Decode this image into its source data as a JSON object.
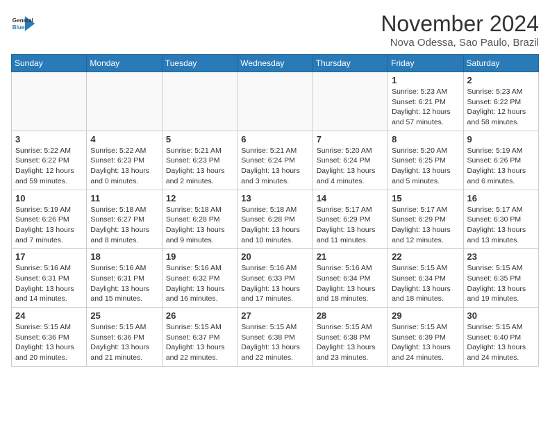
{
  "header": {
    "logo_line1": "General",
    "logo_line2": "Blue",
    "month": "November 2024",
    "location": "Nova Odessa, Sao Paulo, Brazil"
  },
  "weekdays": [
    "Sunday",
    "Monday",
    "Tuesday",
    "Wednesday",
    "Thursday",
    "Friday",
    "Saturday"
  ],
  "weeks": [
    [
      {
        "day": null
      },
      {
        "day": null
      },
      {
        "day": null
      },
      {
        "day": null
      },
      {
        "day": null
      },
      {
        "day": 1,
        "sunrise": "5:23 AM",
        "sunset": "6:21 PM",
        "daylight": "12 hours and 57 minutes"
      },
      {
        "day": 2,
        "sunrise": "5:23 AM",
        "sunset": "6:22 PM",
        "daylight": "12 hours and 58 minutes"
      }
    ],
    [
      {
        "day": 3,
        "sunrise": "5:22 AM",
        "sunset": "6:22 PM",
        "daylight": "12 hours and 59 minutes"
      },
      {
        "day": 4,
        "sunrise": "5:22 AM",
        "sunset": "6:23 PM",
        "daylight": "13 hours and 0 minutes"
      },
      {
        "day": 5,
        "sunrise": "5:21 AM",
        "sunset": "6:23 PM",
        "daylight": "13 hours and 2 minutes"
      },
      {
        "day": 6,
        "sunrise": "5:21 AM",
        "sunset": "6:24 PM",
        "daylight": "13 hours and 3 minutes"
      },
      {
        "day": 7,
        "sunrise": "5:20 AM",
        "sunset": "6:24 PM",
        "daylight": "13 hours and 4 minutes"
      },
      {
        "day": 8,
        "sunrise": "5:20 AM",
        "sunset": "6:25 PM",
        "daylight": "13 hours and 5 minutes"
      },
      {
        "day": 9,
        "sunrise": "5:19 AM",
        "sunset": "6:26 PM",
        "daylight": "13 hours and 6 minutes"
      }
    ],
    [
      {
        "day": 10,
        "sunrise": "5:19 AM",
        "sunset": "6:26 PM",
        "daylight": "13 hours and 7 minutes"
      },
      {
        "day": 11,
        "sunrise": "5:18 AM",
        "sunset": "6:27 PM",
        "daylight": "13 hours and 8 minutes"
      },
      {
        "day": 12,
        "sunrise": "5:18 AM",
        "sunset": "6:28 PM",
        "daylight": "13 hours and 9 minutes"
      },
      {
        "day": 13,
        "sunrise": "5:18 AM",
        "sunset": "6:28 PM",
        "daylight": "13 hours and 10 minutes"
      },
      {
        "day": 14,
        "sunrise": "5:17 AM",
        "sunset": "6:29 PM",
        "daylight": "13 hours and 11 minutes"
      },
      {
        "day": 15,
        "sunrise": "5:17 AM",
        "sunset": "6:29 PM",
        "daylight": "13 hours and 12 minutes"
      },
      {
        "day": 16,
        "sunrise": "5:17 AM",
        "sunset": "6:30 PM",
        "daylight": "13 hours and 13 minutes"
      }
    ],
    [
      {
        "day": 17,
        "sunrise": "5:16 AM",
        "sunset": "6:31 PM",
        "daylight": "13 hours and 14 minutes"
      },
      {
        "day": 18,
        "sunrise": "5:16 AM",
        "sunset": "6:31 PM",
        "daylight": "13 hours and 15 minutes"
      },
      {
        "day": 19,
        "sunrise": "5:16 AM",
        "sunset": "6:32 PM",
        "daylight": "13 hours and 16 minutes"
      },
      {
        "day": 20,
        "sunrise": "5:16 AM",
        "sunset": "6:33 PM",
        "daylight": "13 hours and 17 minutes"
      },
      {
        "day": 21,
        "sunrise": "5:16 AM",
        "sunset": "6:34 PM",
        "daylight": "13 hours and 18 minutes"
      },
      {
        "day": 22,
        "sunrise": "5:15 AM",
        "sunset": "6:34 PM",
        "daylight": "13 hours and 18 minutes"
      },
      {
        "day": 23,
        "sunrise": "5:15 AM",
        "sunset": "6:35 PM",
        "daylight": "13 hours and 19 minutes"
      }
    ],
    [
      {
        "day": 24,
        "sunrise": "5:15 AM",
        "sunset": "6:36 PM",
        "daylight": "13 hours and 20 minutes"
      },
      {
        "day": 25,
        "sunrise": "5:15 AM",
        "sunset": "6:36 PM",
        "daylight": "13 hours and 21 minutes"
      },
      {
        "day": 26,
        "sunrise": "5:15 AM",
        "sunset": "6:37 PM",
        "daylight": "13 hours and 22 minutes"
      },
      {
        "day": 27,
        "sunrise": "5:15 AM",
        "sunset": "6:38 PM",
        "daylight": "13 hours and 22 minutes"
      },
      {
        "day": 28,
        "sunrise": "5:15 AM",
        "sunset": "6:38 PM",
        "daylight": "13 hours and 23 minutes"
      },
      {
        "day": 29,
        "sunrise": "5:15 AM",
        "sunset": "6:39 PM",
        "daylight": "13 hours and 24 minutes"
      },
      {
        "day": 30,
        "sunrise": "5:15 AM",
        "sunset": "6:40 PM",
        "daylight": "13 hours and 24 minutes"
      }
    ]
  ]
}
